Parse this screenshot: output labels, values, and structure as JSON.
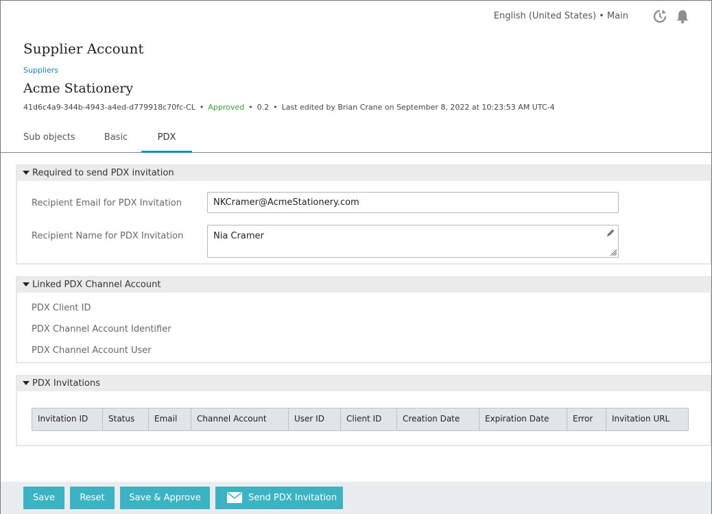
{
  "header": {
    "locale": "English (United States) • Main",
    "page_title": "Supplier Account",
    "breadcrumb": "Suppliers",
    "record_title": "Acme Stationery",
    "record_id": "41d6c4a9-344b-4943-a4ed-d779918c70fc-CL",
    "status": "Approved",
    "version": "0.2",
    "last_edited": "Last edited by Brian Crane on September 8, 2022 at 10:23:53 AM UTC-4"
  },
  "tabs": [
    {
      "label": "Sub objects",
      "active": false
    },
    {
      "label": "Basic",
      "active": false
    },
    {
      "label": "PDX",
      "active": true
    }
  ],
  "sections": {
    "required": {
      "title": "Required to send PDX invitation",
      "email_label": "Recipient Email for PDX Invitation",
      "email_value": "NKCramer@AcmeStationery.com",
      "name_label": "Recipient Name for PDX Invitation",
      "name_value": "Nia Cramer"
    },
    "linked": {
      "title": "Linked PDX Channel Account",
      "client_id_label": "PDX Client ID",
      "channel_identifier_label": "PDX Channel Account Identifier",
      "channel_user_label": "PDX Channel Account User"
    },
    "invitations": {
      "title": "PDX Invitations",
      "columns": [
        "Invitation ID",
        "Status",
        "Email",
        "Channel Account",
        "User ID",
        "Client ID",
        "Creation Date",
        "Expiration Date",
        "Error",
        "Invitation URL"
      ]
    }
  },
  "footer": {
    "save": "Save",
    "reset": "Reset",
    "save_approve": "Save & Approve",
    "send_invitation": "Send PDX Invitation"
  },
  "colors": {
    "accent": "#3bb3c3",
    "tab_underline": "#1a8fb0",
    "approved": "#3a9a3a",
    "link": "#1a7fb5"
  },
  "icons": [
    "refresh-icon",
    "bell-icon",
    "caret-down-icon",
    "pencil-icon",
    "resize-handle-icon",
    "mail-icon"
  ]
}
